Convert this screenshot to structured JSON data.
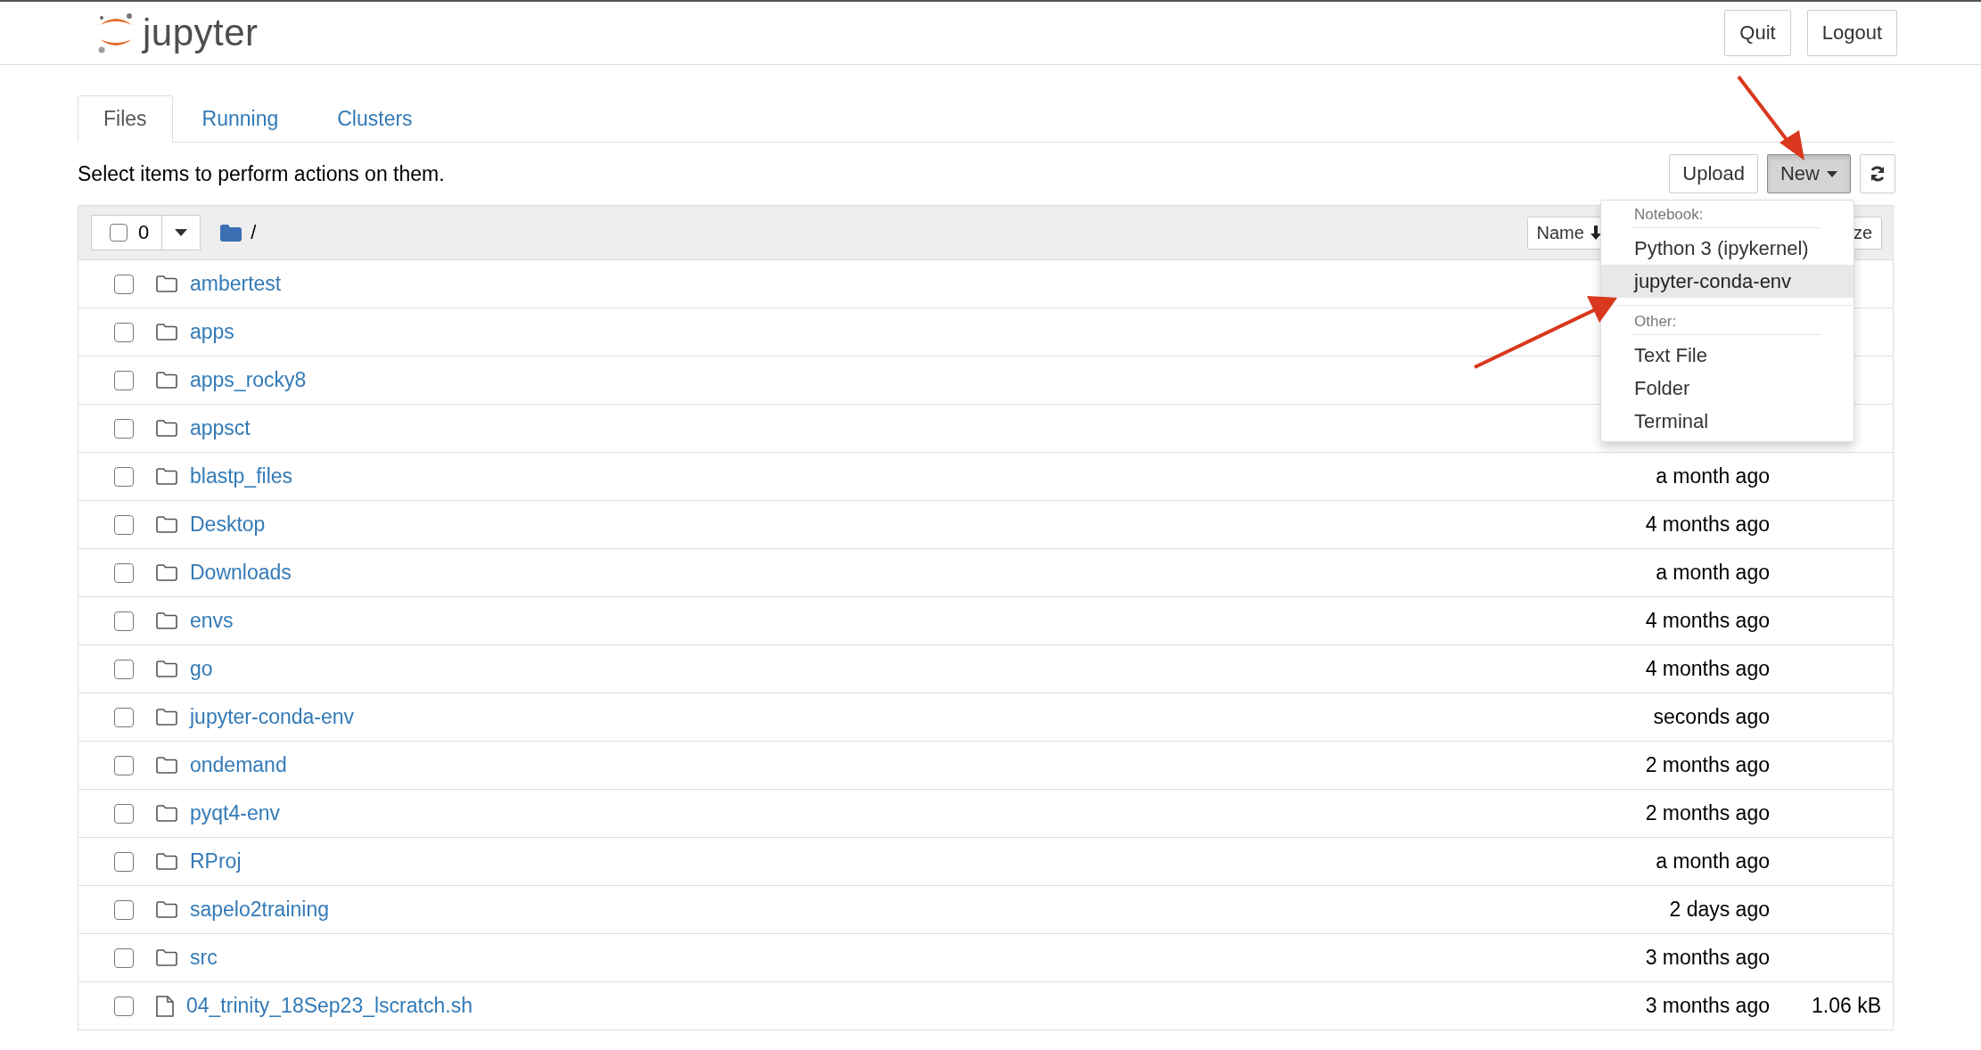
{
  "header": {
    "logo_text": "jupyter",
    "buttons": [
      "Quit",
      "Logout"
    ]
  },
  "tabs": [
    {
      "label": "Files",
      "selected": true
    },
    {
      "label": "Running",
      "selected": false
    },
    {
      "label": "Clusters",
      "selected": false
    }
  ],
  "toolbar": {
    "hint": "Select items to perform actions on them.",
    "upload": "Upload",
    "new": {
      "label": "New",
      "pressed": true
    }
  },
  "list_header": {
    "all_checked": false,
    "selected_count": "0",
    "path": "/",
    "sort_buttons": [
      {
        "label": "Name",
        "sorted": true
      },
      {
        "label": "ze",
        "sorted": false
      }
    ]
  },
  "rows": [
    {
      "name": "ambertest",
      "kind": "folder",
      "checked": false
    },
    {
      "name": "apps",
      "kind": "folder",
      "checked": false
    },
    {
      "name": "apps_rocky8",
      "kind": "folder",
      "checked": false
    },
    {
      "name": "appsct",
      "kind": "folder",
      "checked": false
    },
    {
      "name": "blastp_files",
      "kind": "folder",
      "checked": false,
      "modified": "a month ago"
    },
    {
      "name": "Desktop",
      "kind": "folder",
      "checked": false,
      "modified": "4 months ago"
    },
    {
      "name": "Downloads",
      "kind": "folder",
      "checked": false,
      "modified": "a month ago"
    },
    {
      "name": "envs",
      "kind": "folder",
      "checked": false,
      "modified": "4 months ago"
    },
    {
      "name": "go",
      "kind": "folder",
      "checked": false,
      "modified": "4 months ago"
    },
    {
      "name": "jupyter-conda-env",
      "kind": "folder",
      "checked": false,
      "modified": "seconds ago"
    },
    {
      "name": "ondemand",
      "kind": "folder",
      "checked": false,
      "modified": "2 months ago"
    },
    {
      "name": "pyqt4-env",
      "kind": "folder",
      "checked": false,
      "modified": "2 months ago"
    },
    {
      "name": "RProj",
      "kind": "folder",
      "checked": false,
      "modified": "a month ago"
    },
    {
      "name": "sapelo2training",
      "kind": "folder",
      "checked": false,
      "modified": "2 days ago"
    },
    {
      "name": "src",
      "kind": "folder",
      "checked": false,
      "modified": "3 months ago"
    },
    {
      "name": "04_trinity_18Sep23_lscratch.sh",
      "kind": "file",
      "checked": false,
      "modified": "3 months ago",
      "size": "1.06 kB"
    }
  ],
  "new_menu": {
    "sections": [
      {
        "heading": "Notebook:",
        "items": [
          {
            "label": "Python 3 (ipykernel)",
            "highlighted": false
          },
          {
            "label": "jupyter-conda-env",
            "highlighted": true
          }
        ]
      },
      {
        "heading": "Other:",
        "items": [
          {
            "label": "Text File",
            "highlighted": false
          },
          {
            "label": "Folder",
            "highlighted": false
          },
          {
            "label": "Terminal",
            "highlighted": false
          }
        ]
      }
    ]
  }
}
